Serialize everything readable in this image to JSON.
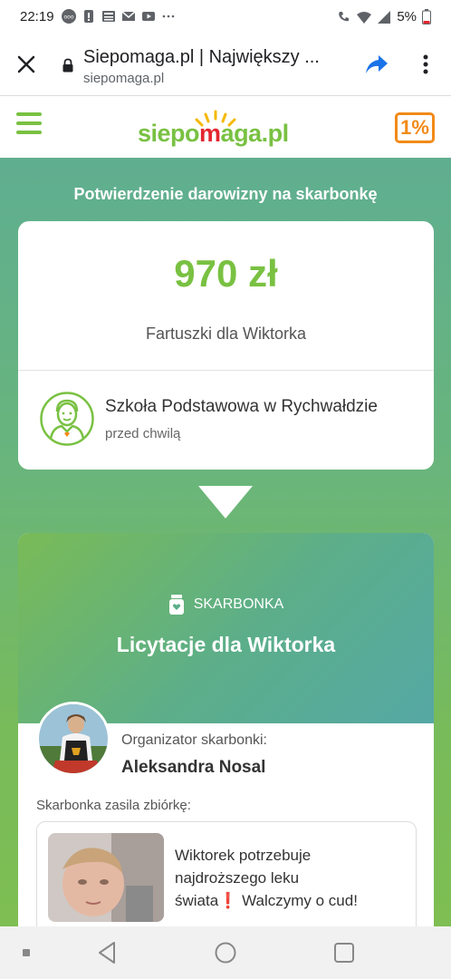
{
  "status_bar": {
    "time": "22:19",
    "battery": "5%",
    "icons": [
      "ooo-icon",
      "alert-icon",
      "news-icon",
      "gmail-icon",
      "youtube-icon",
      "more-icon",
      "wifi-call-icon",
      "wifi-icon",
      "signal-icon",
      "battery-low-icon"
    ]
  },
  "browser": {
    "title": "Siepomaga.pl | Największy ...",
    "url": "siepomaga.pl"
  },
  "site": {
    "logo_text": "siepomaga.pl",
    "one_percent": "1%"
  },
  "confirmation": {
    "heading": "Potwierdzenie darowizny na skarbonkę",
    "amount": "970 zł",
    "cause": "Fartuszki dla Wiktorka",
    "donor_name": "Szkoła Podstawowa w Rychwałdzie",
    "donor_time": "przed chwilą"
  },
  "piggy_bank": {
    "label": "SKARBONKA",
    "title": "Licytacje dla Wiktorka",
    "organizer_label": "Organizator skarbonki:",
    "organizer_name": "Aleksandra Nosal",
    "supports_label": "Skarbonka zasila zbiórkę:",
    "fundraiser_lines": [
      "Wiktorek potrzebuje",
      "najdroższego leku",
      "świata",
      "Walczymy o cud!"
    ],
    "fundraiser_exclaim": "❗"
  },
  "colors": {
    "brand_green": "#79c142",
    "accent_orange": "#f28a18",
    "logo_red": "#e3262f",
    "teal": "#55a8a4"
  }
}
